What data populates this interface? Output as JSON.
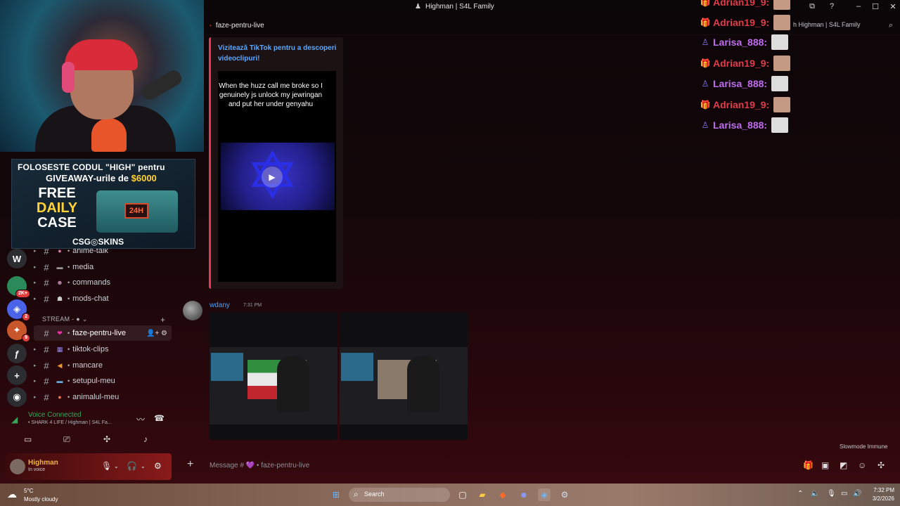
{
  "window": {
    "title": "Highman | S4L Family",
    "minimize": "–",
    "maximize": "☐",
    "close": "✕"
  },
  "ad": {
    "line1": "FOLOSESTE CODUL \"HIGH\" pentru",
    "line2_prefix": "GIVEAWAY-urile de",
    "line2_amount": "$6000",
    "free1": "FREE",
    "free2": "DAILY",
    "free3": "CASE",
    "timer": "24H",
    "brand": "CSG◎SKINS"
  },
  "rail": [
    {
      "label": "W",
      "color": "#2b2d31",
      "badge": ""
    },
    {
      "label": "2K+",
      "color": "#2b8a5a",
      "badge": "2K+"
    },
    {
      "label": "◈",
      "color": "#4a63e8",
      "badge": "2"
    },
    {
      "label": "✦",
      "color": "#c8562a",
      "badge": "9"
    },
    {
      "label": "ƒ",
      "color": "#2b2d31",
      "badge": ""
    },
    {
      "label": "+",
      "color": "#2b2d31",
      "badge": ""
    },
    {
      "label": "◉",
      "color": "#2b2d31",
      "badge": ""
    }
  ],
  "channels": {
    "anime_talk": "anime-talk",
    "media": "media",
    "commands": "commands",
    "mods_chat": "mods-chat",
    "category": "STREAM - ● ⌄",
    "category_plus": "+",
    "faze_pentru_live": "faze-pentru-live",
    "tiktok_clips": "tiktok-clips",
    "mancare": "mancare",
    "setupul_meu": "setupul-meu",
    "animalul_meu": "animalul-meu"
  },
  "voice": {
    "title": "Voice Connected",
    "subtitle": "• SHARK 4 LIFE / Highman | S4L Fa..."
  },
  "user": {
    "name": "Highman",
    "status": "In voice"
  },
  "header": {
    "channel": "faze-pentru-live",
    "search_placeholder": "h Highman | S4L Family"
  },
  "embed": {
    "title": "Vizitează TikTok pentru a descoperi videoclipuri!",
    "caption": "When the huzz call me broke so I genuinely js unlock my jewringan and put her under genyahu"
  },
  "message": {
    "author": "wdany",
    "time": "7:31 PM"
  },
  "overlay_chat": [
    {
      "name": "Adrian19_9:",
      "color": "#e23b4a",
      "icon": "🎁"
    },
    {
      "name": "Adrian19_9:",
      "color": "#e23b4a",
      "icon": "🎁"
    },
    {
      "name": "Larisa_888:",
      "color": "#c06cf0",
      "icon": "♙"
    },
    {
      "name": "Adrian19_9:",
      "color": "#e23b4a",
      "icon": "🎁"
    },
    {
      "name": "Larisa_888:",
      "color": "#c06cf0",
      "icon": "♙"
    },
    {
      "name": "Adrian19_9:",
      "color": "#e23b4a",
      "icon": "🎁"
    },
    {
      "name": "Larisa_888:",
      "color": "#c06cf0",
      "icon": "♙"
    }
  ],
  "slowmode": "Slowmode Immune",
  "composer": {
    "placeholder": "Message # 💜 • faze-pentru-live"
  },
  "taskbar": {
    "temp": "5°C",
    "condition": "Mostly cloudy",
    "search": "Search",
    "time": "7:32 PM",
    "date": "3/2/2026"
  }
}
